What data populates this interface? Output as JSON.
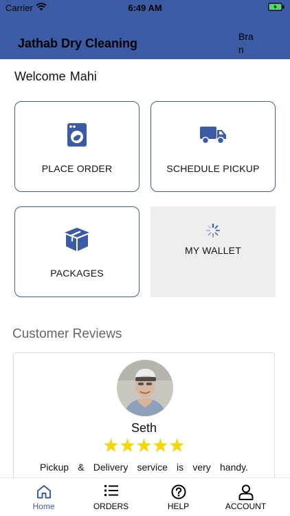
{
  "status_bar": {
    "carrier": "Carrier",
    "time": "6:49 AM"
  },
  "header": {
    "title": "Jathab Dry Cleaning",
    "branch_text": "Bran",
    "background_color": "#3b5ba5"
  },
  "welcome": {
    "greeting": "Welcome",
    "user_name": "Mahi"
  },
  "tiles": [
    {
      "label": "PLACE ORDER",
      "icon": "washing-machine-icon"
    },
    {
      "label": "SCHEDULE PICKUP",
      "icon": "truck-icon"
    },
    {
      "label": "PACKAGES",
      "icon": "package-icon"
    },
    {
      "label": "MY WALLET",
      "icon": "loading-spinner-icon"
    }
  ],
  "reviews": {
    "title": "Customer Reviews",
    "items": [
      {
        "name": "Seth",
        "rating": 5,
        "text": "Pickup & Delivery service is very handy."
      }
    ]
  },
  "tab_bar": {
    "tabs": [
      {
        "label": "Home",
        "icon": "home-icon",
        "active": true
      },
      {
        "label": "ORDERS",
        "icon": "list-icon",
        "active": false
      },
      {
        "label": "HELP",
        "icon": "help-icon",
        "active": false
      },
      {
        "label": "ACCOUNT",
        "icon": "user-icon",
        "active": false
      }
    ]
  },
  "colors": {
    "accent": "#3b5ba5",
    "star": "#f5d60b",
    "wallet_tile_bg": "#eeeeee"
  }
}
